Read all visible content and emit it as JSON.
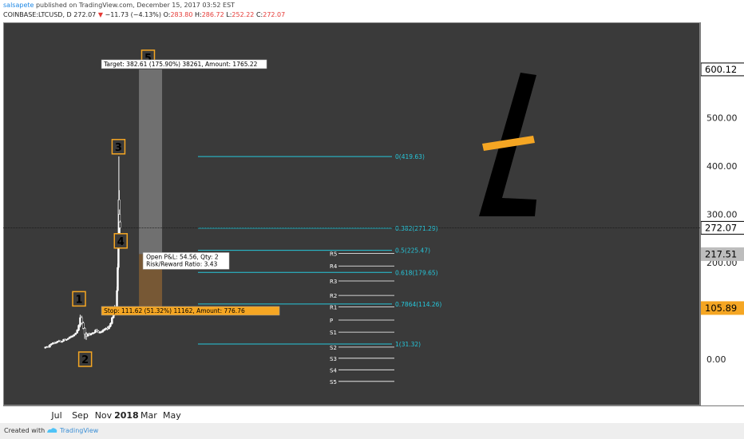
{
  "header": {
    "publisher": "salsapete",
    "published": "published on TradingView.com, December 15, 2017 03:52 EST",
    "symbol": "COINBASE:LTCUSD, D",
    "price": "272.07",
    "change": "−11.73 (−4.13%)",
    "o_key": "O:",
    "o_val": "283.80",
    "h_key": "H:",
    "h_val": "286.72",
    "l_key": "L:",
    "l_val": "252.22",
    "c_key": "C:",
    "c_val": "272.07"
  },
  "footer": {
    "created_with": "Created with",
    "brand": "TradingView"
  },
  "colors": {
    "background": "#3a3a3a",
    "fib": "#26c6da",
    "label_border": "#f5a623",
    "target_zone": "#777777",
    "stop_zone": "#7a5a35",
    "stop_label": "#f5a623",
    "price_line": "#111111"
  },
  "chart_data": {
    "type": "candlestick",
    "symbol": "COINBASE:LTCUSD",
    "timeframe": "D",
    "x_ticks": [
      "Jul",
      "Sep",
      "Nov",
      "2018",
      "Mar",
      "May"
    ],
    "y_ticks": [
      "0.00",
      "100.00",
      "200.00",
      "300.00",
      "400.00",
      "500.00"
    ],
    "ylim": [
      -50,
      660
    ],
    "price_labels": [
      {
        "text": "600.12",
        "value": 600.12,
        "style": "white"
      },
      {
        "text": "272.07",
        "value": 272.07,
        "style": "white"
      },
      {
        "text": "217.51",
        "value": 217.51,
        "style": "grey"
      },
      {
        "text": "105.89",
        "value": 105.89,
        "style": "orange"
      }
    ],
    "fib_levels": [
      {
        "label": "0(419.63)",
        "value": 419.63
      },
      {
        "label": "0.382(271.29)",
        "value": 271.29
      },
      {
        "label": "0.5(225.47)",
        "value": 225.47
      },
      {
        "label": "0.618(179.65)",
        "value": 179.65
      },
      {
        "label": "0.7864(114.26)",
        "value": 114.26
      },
      {
        "label": "1(31.32)",
        "value": 31.32
      }
    ],
    "pivots": [
      {
        "label": "R5",
        "value": 219
      },
      {
        "label": "R4",
        "value": 193
      },
      {
        "label": "R3",
        "value": 162
      },
      {
        "label": "R2",
        "value": 132
      },
      {
        "label": "R1",
        "value": 108
      },
      {
        "label": "P",
        "value": 81
      },
      {
        "label": "S1",
        "value": 56
      },
      {
        "label": "S2",
        "value": 25
      },
      {
        "label": "S3",
        "value": 2
      },
      {
        "label": "S4",
        "value": -22
      },
      {
        "label": "S5",
        "value": -46
      }
    ],
    "wave_labels": [
      {
        "text": "1",
        "date": "2017-08-29",
        "value": 125
      },
      {
        "text": "2",
        "date": "2017-09-14",
        "value": 0
      },
      {
        "text": "3",
        "date": "2017-12-11",
        "value": 440
      },
      {
        "text": "4",
        "date": "2017-12-17",
        "value": 245
      },
      {
        "text": "5",
        "date": "2018-02-27",
        "value": 625
      }
    ],
    "position": {
      "target_label": "Target: 382.61 (175.90%) 38261, Amount: 1765.22",
      "stop_label": "Stop: 111.62 (51.32%) 11162, Amount: 776.76",
      "pnl_label": "Open P&L: 54.56, Qty: 2",
      "rr_label": "Risk/Reward Ratio: 3.43",
      "entry": 217.51,
      "target": 600.12,
      "stop": 105.89,
      "start": "2018-02-03",
      "end": "2018-04-05"
    },
    "current_price": 272.07,
    "candles": [
      [
        "2017-06-01",
        23,
        26,
        22,
        25
      ],
      [
        "2017-06-05",
        25,
        27,
        24,
        26
      ],
      [
        "2017-06-09",
        26,
        28,
        24,
        25
      ],
      [
        "2017-06-13",
        25,
        31,
        24,
        30
      ],
      [
        "2017-06-17",
        30,
        33,
        28,
        32
      ],
      [
        "2017-06-21",
        32,
        35,
        30,
        34
      ],
      [
        "2017-06-25",
        34,
        36,
        31,
        33
      ],
      [
        "2017-06-29",
        33,
        36,
        32,
        35
      ],
      [
        "2017-07-03",
        35,
        38,
        33,
        37
      ],
      [
        "2017-07-07",
        37,
        40,
        36,
        38
      ],
      [
        "2017-07-11",
        38,
        39,
        35,
        36
      ],
      [
        "2017-07-15",
        36,
        38,
        34,
        37
      ],
      [
        "2017-07-19",
        37,
        42,
        36,
        41
      ],
      [
        "2017-07-23",
        41,
        43,
        39,
        40
      ],
      [
        "2017-07-27",
        40,
        42,
        38,
        41
      ],
      [
        "2017-07-31",
        41,
        44,
        40,
        43
      ],
      [
        "2017-08-04",
        43,
        47,
        42,
        46
      ],
      [
        "2017-08-08",
        46,
        49,
        44,
        47
      ],
      [
        "2017-08-12",
        47,
        50,
        45,
        48
      ],
      [
        "2017-08-16",
        48,
        52,
        47,
        51
      ],
      [
        "2017-08-20",
        51,
        55,
        50,
        54
      ],
      [
        "2017-08-24",
        54,
        62,
        53,
        60
      ],
      [
        "2017-08-28",
        60,
        72,
        58,
        70
      ],
      [
        "2017-09-01",
        70,
        92,
        66,
        86
      ],
      [
        "2017-09-05",
        86,
        90,
        72,
        75
      ],
      [
        "2017-09-09",
        75,
        78,
        62,
        64
      ],
      [
        "2017-09-13",
        64,
        66,
        42,
        52
      ],
      [
        "2017-09-17",
        52,
        56,
        40,
        48
      ],
      [
        "2017-09-21",
        48,
        54,
        46,
        52
      ],
      [
        "2017-09-25",
        52,
        55,
        48,
        50
      ],
      [
        "2017-09-29",
        50,
        54,
        49,
        53
      ],
      [
        "2017-10-03",
        53,
        56,
        51,
        54
      ],
      [
        "2017-10-07",
        54,
        56,
        52,
        55
      ],
      [
        "2017-10-11",
        55,
        62,
        54,
        60
      ],
      [
        "2017-10-15",
        60,
        63,
        56,
        58
      ],
      [
        "2017-10-19",
        58,
        60,
        54,
        55
      ],
      [
        "2017-10-23",
        55,
        58,
        53,
        56
      ],
      [
        "2017-10-27",
        56,
        59,
        54,
        57
      ],
      [
        "2017-10-31",
        57,
        62,
        55,
        60
      ],
      [
        "2017-11-04",
        60,
        64,
        58,
        62
      ],
      [
        "2017-11-08",
        62,
        66,
        60,
        64
      ],
      [
        "2017-11-12",
        64,
        68,
        60,
        63
      ],
      [
        "2017-11-16",
        63,
        70,
        62,
        68
      ],
      [
        "2017-11-20",
        68,
        76,
        66,
        74
      ],
      [
        "2017-11-24",
        74,
        88,
        72,
        86
      ],
      [
        "2017-11-28",
        86,
        102,
        84,
        98
      ],
      [
        "2017-12-01",
        98,
        112,
        90,
        102
      ],
      [
        "2017-12-04",
        102,
        108,
        94,
        100
      ],
      [
        "2017-12-07",
        100,
        150,
        98,
        142
      ],
      [
        "2017-12-09",
        142,
        198,
        140,
        190
      ],
      [
        "2017-12-11",
        190,
        245,
        185,
        230
      ],
      [
        "2017-12-12",
        230,
        420,
        225,
        330
      ],
      [
        "2017-12-13",
        330,
        350,
        260,
        300
      ],
      [
        "2017-12-14",
        300,
        310,
        255,
        284
      ],
      [
        "2017-12-15",
        284,
        287,
        252,
        272
      ]
    ]
  }
}
